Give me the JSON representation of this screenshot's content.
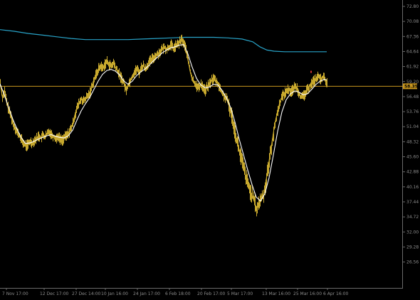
{
  "chart_data": {
    "type": "line",
    "colors": {
      "background": "#000000",
      "price": "#c8a92e",
      "fast_ma": "#ffffff",
      "slow_ma": "#28a3c8",
      "current_line": "#c8961e",
      "axis_text": "#8c8c8c",
      "marker": "#d23232"
    },
    "y_ticks": [
      "72.80",
      "70.08",
      "67.36",
      "64.64",
      "61.92",
      "59.20",
      "56.48",
      "53.76",
      "51.04",
      "48.32",
      "45.60",
      "42.88",
      "40.16",
      "37.44",
      "34.72",
      "32.00",
      "29.28",
      "26.56"
    ],
    "x_ticks": [
      "7 Nov 17:00",
      "12 Dec 17:00",
      "27 Dec 14:00",
      "10 Jan 16:00",
      "24 Jan 17:00",
      "6 Feb 18:00",
      "20 Feb 17:00",
      "5 Mar 17:00",
      "13 Mar 16:00",
      "25 Mar 16:00",
      "6 Apr 16:00"
    ],
    "ylim": [
      26.56,
      72.8
    ],
    "current_price": "58.35",
    "current_value": 58.35,
    "price_series": [
      [
        0,
        59.0
      ],
      [
        3,
        56.5
      ],
      [
        6,
        57.5
      ],
      [
        9,
        55.5
      ],
      [
        12,
        54.0
      ],
      [
        15,
        53.0
      ],
      [
        18,
        51.5
      ],
      [
        21,
        50.8
      ],
      [
        24,
        50.0
      ],
      [
        27,
        49.3
      ],
      [
        30,
        48.6
      ],
      [
        33,
        48.0
      ],
      [
        36,
        47.6
      ],
      [
        39,
        47.8
      ],
      [
        42,
        48.4
      ],
      [
        45,
        48.1
      ],
      [
        48,
        48.6
      ],
      [
        51,
        48.9
      ],
      [
        54,
        49.4
      ],
      [
        57,
        49.0
      ],
      [
        60,
        49.5
      ],
      [
        63,
        49.2
      ],
      [
        66,
        49.8
      ],
      [
        69,
        50.2
      ],
      [
        72,
        49.6
      ],
      [
        75,
        49.3
      ],
      [
        78,
        48.9
      ],
      [
        81,
        49.3
      ],
      [
        84,
        48.8
      ],
      [
        87,
        48.6
      ],
      [
        90,
        49.1
      ],
      [
        93,
        49.4
      ],
      [
        96,
        49.9
      ],
      [
        99,
        50.6
      ],
      [
        102,
        51.6
      ],
      [
        105,
        53.2
      ],
      [
        108,
        54.5
      ],
      [
        111,
        55.4
      ],
      [
        114,
        56.0
      ],
      [
        117,
        55.6
      ],
      [
        120,
        56.1
      ],
      [
        123,
        56.6
      ],
      [
        126,
        57.2
      ],
      [
        129,
        58.5
      ],
      [
        132,
        59.6
      ],
      [
        135,
        60.6
      ],
      [
        138,
        61.5
      ],
      [
        141,
        62.0
      ],
      [
        144,
        61.6
      ],
      [
        147,
        62.4
      ],
      [
        150,
        62.8
      ],
      [
        153,
        62.3
      ],
      [
        156,
        61.9
      ],
      [
        159,
        62.6
      ],
      [
        162,
        61.7
      ],
      [
        165,
        61.0
      ],
      [
        168,
        60.3
      ],
      [
        171,
        59.6
      ],
      [
        174,
        58.8
      ],
      [
        177,
        57.6
      ],
      [
        180,
        58.7
      ],
      [
        183,
        59.5
      ],
      [
        186,
        60.3
      ],
      [
        189,
        61.0
      ],
      [
        192,
        61.5
      ],
      [
        195,
        60.8
      ],
      [
        198,
        61.7
      ],
      [
        201,
        62.1
      ],
      [
        204,
        61.5
      ],
      [
        207,
        62.3
      ],
      [
        210,
        62.8
      ],
      [
        213,
        63.2
      ],
      [
        216,
        63.6
      ],
      [
        219,
        64.0
      ],
      [
        222,
        64.3
      ],
      [
        225,
        64.7
      ],
      [
        228,
        65.1
      ],
      [
        231,
        65.4
      ],
      [
        234,
        65.0
      ],
      [
        237,
        65.5
      ],
      [
        240,
        65.8
      ],
      [
        243,
        65.2
      ],
      [
        246,
        65.6
      ],
      [
        249,
        65.9
      ],
      [
        252,
        66.3
      ],
      [
        255,
        66.8
      ],
      [
        258,
        66.0
      ],
      [
        261,
        65.0
      ],
      [
        264,
        63.0
      ],
      [
        267,
        61.0
      ],
      [
        270,
        59.5
      ],
      [
        273,
        59.0
      ],
      [
        276,
        58.4
      ],
      [
        279,
        58.0
      ],
      [
        282,
        58.8
      ],
      [
        285,
        58.2
      ],
      [
        288,
        57.5
      ],
      [
        291,
        58.3
      ],
      [
        294,
        58.8
      ],
      [
        297,
        59.5
      ],
      [
        300,
        59.8
      ],
      [
        303,
        59.2
      ],
      [
        306,
        58.8
      ],
      [
        309,
        57.8
      ],
      [
        312,
        57.0
      ],
      [
        315,
        56.5
      ],
      [
        318,
        56.0
      ],
      [
        321,
        55.0
      ],
      [
        324,
        53.5
      ],
      [
        327,
        52.0
      ],
      [
        330,
        50.0
      ],
      [
        333,
        48.2
      ],
      [
        336,
        46.5
      ],
      [
        339,
        45.0
      ],
      [
        342,
        43.5
      ],
      [
        345,
        42.0
      ],
      [
        348,
        40.5
      ],
      [
        351,
        39.5
      ],
      [
        354,
        38.5
      ],
      [
        357,
        37.5
      ],
      [
        360,
        36.0
      ],
      [
        363,
        37.0
      ],
      [
        366,
        38.0
      ],
      [
        369,
        38.5
      ],
      [
        372,
        40.0
      ],
      [
        375,
        42.5
      ],
      [
        378,
        45.0
      ],
      [
        381,
        47.5
      ],
      [
        384,
        50.0
      ],
      [
        387,
        52.2
      ],
      [
        390,
        54.0
      ],
      [
        393,
        55.5
      ],
      [
        396,
        56.5
      ],
      [
        399,
        57.0
      ],
      [
        402,
        57.5
      ],
      [
        405,
        57.8
      ],
      [
        408,
        57.4
      ],
      [
        411,
        57.7
      ],
      [
        414,
        58.2
      ],
      [
        417,
        58.0
      ],
      [
        420,
        57.0
      ],
      [
        423,
        56.3
      ],
      [
        426,
        56.5
      ],
      [
        429,
        57.2
      ],
      [
        432,
        57.8
      ],
      [
        435,
        58.5
      ],
      [
        438,
        59.0
      ],
      [
        441,
        59.4
      ],
      [
        444,
        59.8
      ],
      [
        447,
        60.1
      ],
      [
        450,
        59.6
      ],
      [
        453,
        60.0
      ],
      [
        456,
        59.6
      ],
      [
        459,
        58.9
      ]
    ],
    "fast_ma_series": [
      [
        0,
        58.8
      ],
      [
        6,
        56.8
      ],
      [
        12,
        54.6
      ],
      [
        18,
        52.4
      ],
      [
        24,
        50.6
      ],
      [
        30,
        49.0
      ],
      [
        36,
        48.0
      ],
      [
        42,
        48.1
      ],
      [
        48,
        48.4
      ],
      [
        54,
        48.8
      ],
      [
        60,
        49.1
      ],
      [
        66,
        49.4
      ],
      [
        72,
        49.6
      ],
      [
        78,
        49.3
      ],
      [
        84,
        49.1
      ],
      [
        90,
        49.0
      ],
      [
        96,
        49.4
      ],
      [
        102,
        50.4
      ],
      [
        108,
        52.2
      ],
      [
        114,
        53.9
      ],
      [
        120,
        55.2
      ],
      [
        126,
        56.3
      ],
      [
        132,
        57.8
      ],
      [
        138,
        59.3
      ],
      [
        144,
        60.5
      ],
      [
        150,
        61.2
      ],
      [
        156,
        61.4
      ],
      [
        162,
        61.1
      ],
      [
        168,
        60.4
      ],
      [
        174,
        59.3
      ],
      [
        180,
        58.7
      ],
      [
        186,
        59.3
      ],
      [
        192,
        60.3
      ],
      [
        198,
        61.0
      ],
      [
        204,
        61.5
      ],
      [
        210,
        62.2
      ],
      [
        216,
        63.0
      ],
      [
        222,
        63.7
      ],
      [
        228,
        64.4
      ],
      [
        234,
        64.9
      ],
      [
        240,
        65.3
      ],
      [
        246,
        65.5
      ],
      [
        252,
        65.8
      ],
      [
        258,
        65.9
      ],
      [
        264,
        64.2
      ],
      [
        270,
        61.8
      ],
      [
        276,
        59.8
      ],
      [
        282,
        58.6
      ],
      [
        288,
        58.1
      ],
      [
        294,
        58.2
      ],
      [
        300,
        58.7
      ],
      [
        306,
        58.6
      ],
      [
        312,
        57.6
      ],
      [
        318,
        56.3
      ],
      [
        324,
        54.5
      ],
      [
        330,
        51.9
      ],
      [
        336,
        48.8
      ],
      [
        342,
        46.0
      ],
      [
        348,
        43.2
      ],
      [
        354,
        40.6
      ],
      [
        360,
        38.3
      ],
      [
        366,
        37.6
      ],
      [
        372,
        38.9
      ],
      [
        378,
        41.8
      ],
      [
        384,
        45.9
      ],
      [
        390,
        50.2
      ],
      [
        396,
        53.7
      ],
      [
        402,
        55.9
      ],
      [
        408,
        57.0
      ],
      [
        414,
        57.5
      ],
      [
        420,
        57.3
      ],
      [
        426,
        56.8
      ],
      [
        432,
        57.0
      ],
      [
        438,
        57.8
      ],
      [
        444,
        58.7
      ],
      [
        450,
        59.3
      ],
      [
        456,
        59.6
      ],
      [
        459,
        59.5
      ]
    ],
    "slow_ma_series": [
      [
        0,
        68.6
      ],
      [
        20,
        68.3
      ],
      [
        40,
        67.9
      ],
      [
        60,
        67.6
      ],
      [
        80,
        67.3
      ],
      [
        100,
        67.0
      ],
      [
        120,
        66.8
      ],
      [
        140,
        66.8
      ],
      [
        160,
        66.8
      ],
      [
        180,
        66.8
      ],
      [
        200,
        66.9
      ],
      [
        220,
        67.0
      ],
      [
        240,
        67.1
      ],
      [
        260,
        67.2
      ],
      [
        280,
        67.2
      ],
      [
        300,
        67.2
      ],
      [
        320,
        67.1
      ],
      [
        340,
        66.9
      ],
      [
        355,
        66.4
      ],
      [
        365,
        65.5
      ],
      [
        375,
        64.9
      ],
      [
        385,
        64.7
      ],
      [
        400,
        64.6
      ],
      [
        420,
        64.6
      ],
      [
        440,
        64.6
      ],
      [
        459,
        64.6
      ]
    ],
    "markers": [
      [
        437,
        60.9
      ]
    ]
  }
}
